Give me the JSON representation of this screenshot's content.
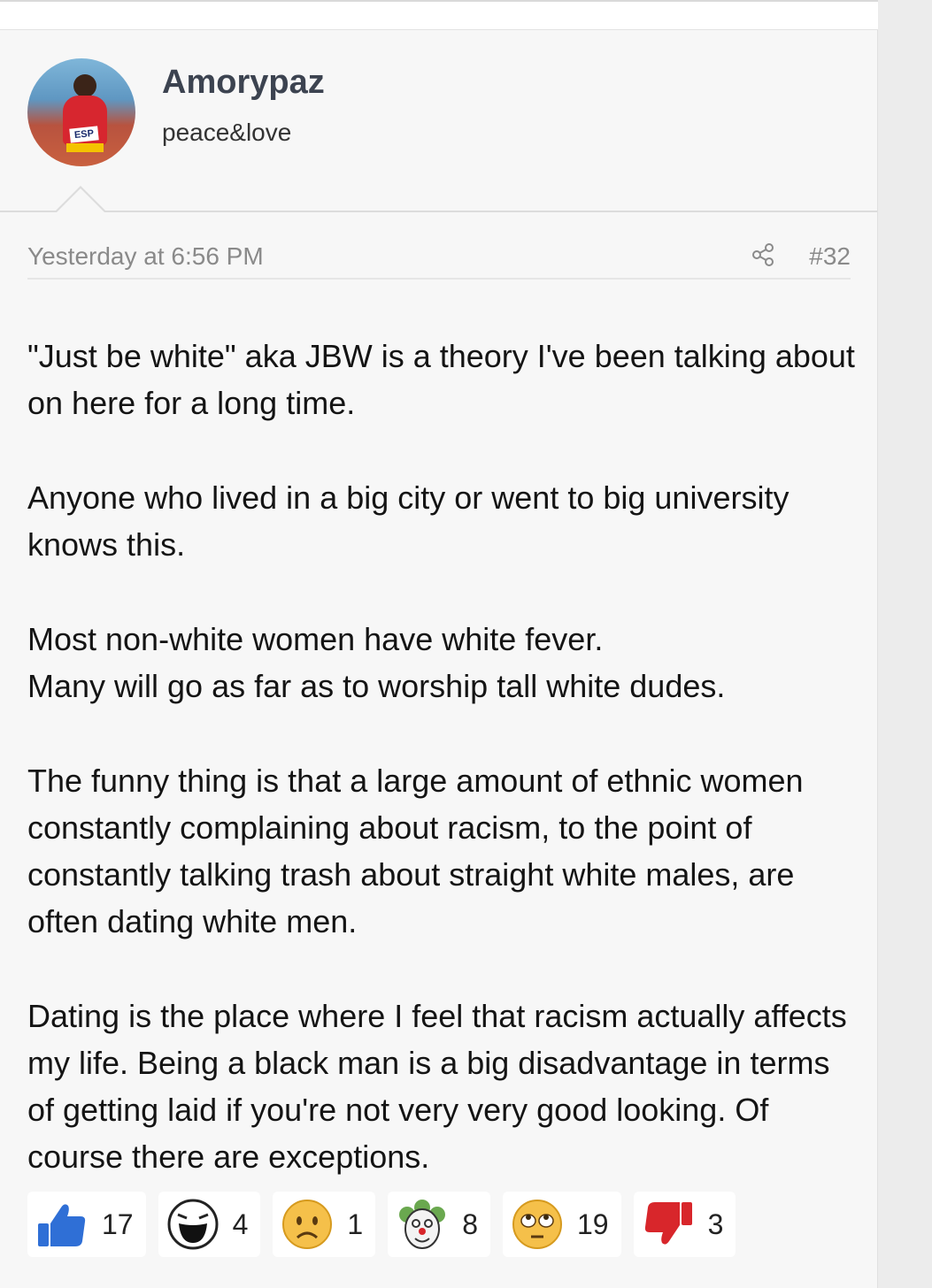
{
  "user": {
    "name": "Amorypaz",
    "title": "peace&love",
    "avatar_bib_text": "ESP"
  },
  "post": {
    "date": "Yesterday at 6:56 PM",
    "number": "#32",
    "paragraphs": [
      "\"Just be white\" aka JBW is a theory I've been talking about on here for a long time.",
      "Anyone who lived in a big city or went to big university knows this.",
      "Most non-white women have white fever.\nMany will go as far as to worship tall white dudes.",
      "The funny thing is that a large amount of ethnic women constantly complaining about racism, to the point of constantly talking trash about straight white males, are often dating white men.",
      "Dating is the place where I feel that racism actually affects my life. Being a black man is a big disadvantage in terms of getting laid if you're not very very good looking. Of course there are exceptions."
    ]
  },
  "reactions": [
    {
      "icon": "thumbs-up-icon",
      "count": "17"
    },
    {
      "icon": "laughing-face-icon",
      "count": "4"
    },
    {
      "icon": "sad-face-icon",
      "count": "1"
    },
    {
      "icon": "clown-face-icon",
      "count": "8"
    },
    {
      "icon": "eye-roll-face-icon",
      "count": "19"
    },
    {
      "icon": "thumbs-down-icon",
      "count": "3"
    }
  ],
  "colors": {
    "background": "#f7f7f7",
    "username": "#3c4350",
    "meta_text": "#8a8a8a",
    "like_blue": "#2f6fd6",
    "dislike_red": "#d8262b"
  }
}
